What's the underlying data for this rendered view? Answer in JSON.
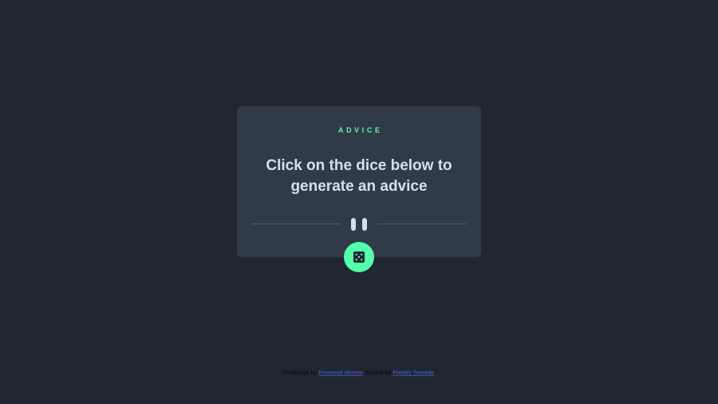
{
  "card": {
    "label": "ADVICE",
    "advice_text": "Click on the dice below to generate an advice"
  },
  "dice_button": {
    "icon": "dice-icon"
  },
  "footer": {
    "prefix": "Challenge by",
    "challenge_link": "Frontend Mentor",
    "middle": ". Coded by",
    "author_link": "Freddy Tomeda",
    "suffix": "."
  },
  "colors": {
    "background": "#202733",
    "card": "#313A49",
    "accent": "#53FFAA",
    "text": "#CEE3E9",
    "divider": "#4F5D74",
    "link": "#3E52A3"
  }
}
